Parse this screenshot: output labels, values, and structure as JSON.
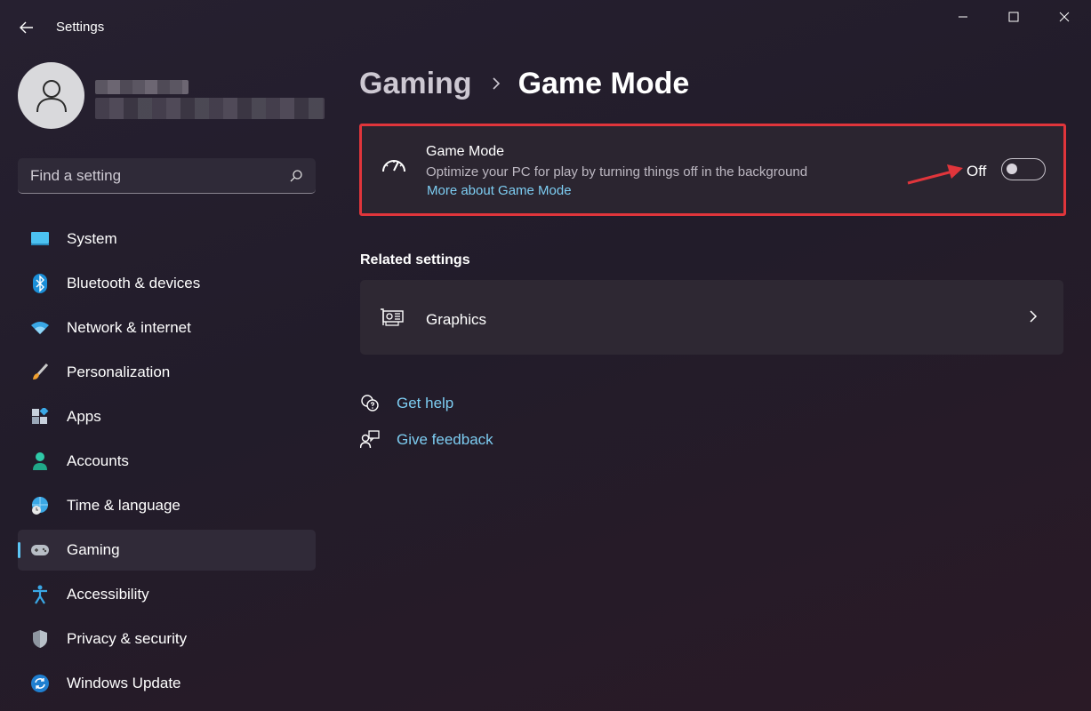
{
  "window": {
    "title": "Settings"
  },
  "search": {
    "placeholder": "Find a setting"
  },
  "sidebar": {
    "items": [
      {
        "label": "System",
        "icon": "system-icon"
      },
      {
        "label": "Bluetooth & devices",
        "icon": "bluetooth-icon"
      },
      {
        "label": "Network & internet",
        "icon": "wifi-icon"
      },
      {
        "label": "Personalization",
        "icon": "brush-icon"
      },
      {
        "label": "Apps",
        "icon": "apps-icon"
      },
      {
        "label": "Accounts",
        "icon": "person-icon"
      },
      {
        "label": "Time & language",
        "icon": "globe-clock-icon"
      },
      {
        "label": "Gaming",
        "icon": "gamepad-icon",
        "active": true
      },
      {
        "label": "Accessibility",
        "icon": "accessibility-icon"
      },
      {
        "label": "Privacy & security",
        "icon": "shield-icon"
      },
      {
        "label": "Windows Update",
        "icon": "update-icon"
      }
    ]
  },
  "breadcrumb": {
    "parent": "Gaming",
    "current": "Game Mode"
  },
  "game_mode": {
    "title": "Game Mode",
    "description": "Optimize your PC for play by turning things off in the background",
    "link": "More about Game Mode",
    "state_label": "Off",
    "enabled": false
  },
  "related": {
    "heading": "Related settings",
    "items": [
      {
        "label": "Graphics",
        "icon": "graphics-card-icon"
      }
    ]
  },
  "help": {
    "get_help": "Get help",
    "give_feedback": "Give feedback"
  },
  "colors": {
    "accent": "#5cc6f5",
    "link": "#7dcdf2",
    "highlight_border": "#e0353b"
  }
}
